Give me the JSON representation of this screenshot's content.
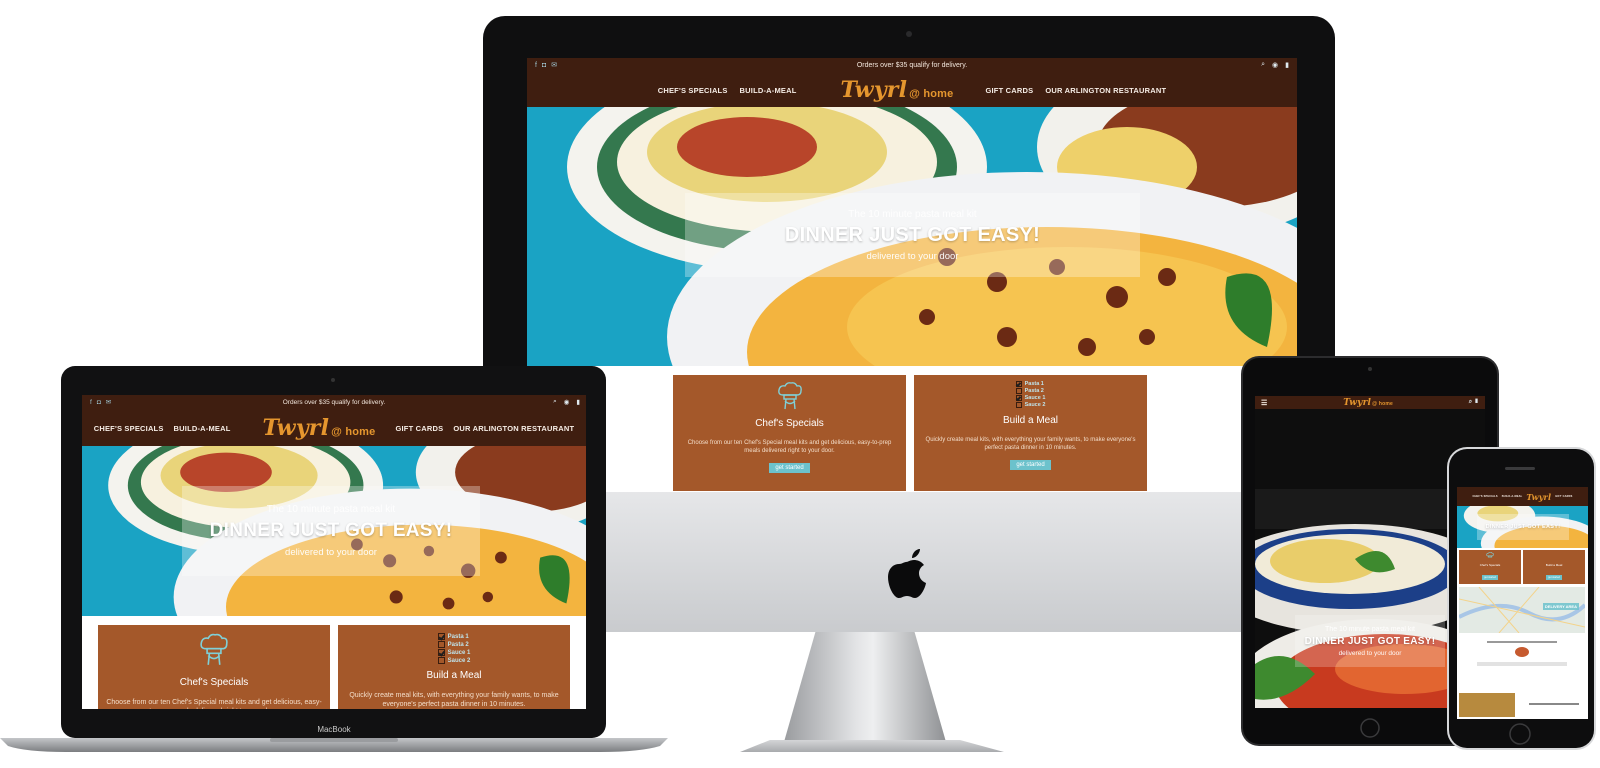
{
  "site": {
    "promo": "Orders over $35 qualify for delivery.",
    "nav_left": [
      "CHEF'S SPECIALS",
      "BUILD-A-MEAL"
    ],
    "nav_right": [
      "GIFT CARDS",
      "OUR ARLINGTON RESTAURANT"
    ],
    "logo_script": "Twyrl",
    "logo_suffix": "@ home",
    "hero": {
      "kicker": "The 10 minute pasta meal kit",
      "headline": "DINNER JUST GOT EASY!",
      "subline": "delivered to your door"
    },
    "cards": [
      {
        "title": "Chef's Specials",
        "body": "Choose from our ten Chef's Special meal kits and get delicious, easy-to-prep meals delivered right to your door.",
        "button": "get started",
        "icon": "chef-hat-icon"
      },
      {
        "title": "Build a Meal",
        "body": "Quickly create meal kits, with everything your family wants, to make everyone's perfect pasta dinner in 10 minutes.",
        "button": "get started",
        "icon": "checklist-icon",
        "checklist": [
          {
            "label": "Pasta 1",
            "checked": true
          },
          {
            "label": "Pasta 2",
            "checked": false
          },
          {
            "label": "Sauce 1",
            "checked": true
          },
          {
            "label": "Sauce 2",
            "checked": false
          }
        ]
      }
    ],
    "delivery_area_label": "DELIVERY AREA"
  },
  "device_labels": {
    "laptop": "MacBook"
  },
  "colors": {
    "nav_brown": "#3f1e10",
    "card_rust": "#a4582a",
    "button_teal": "#6cc2cc",
    "logo_orange": "#e5962e",
    "hero_teal": "#1b9fbf"
  }
}
